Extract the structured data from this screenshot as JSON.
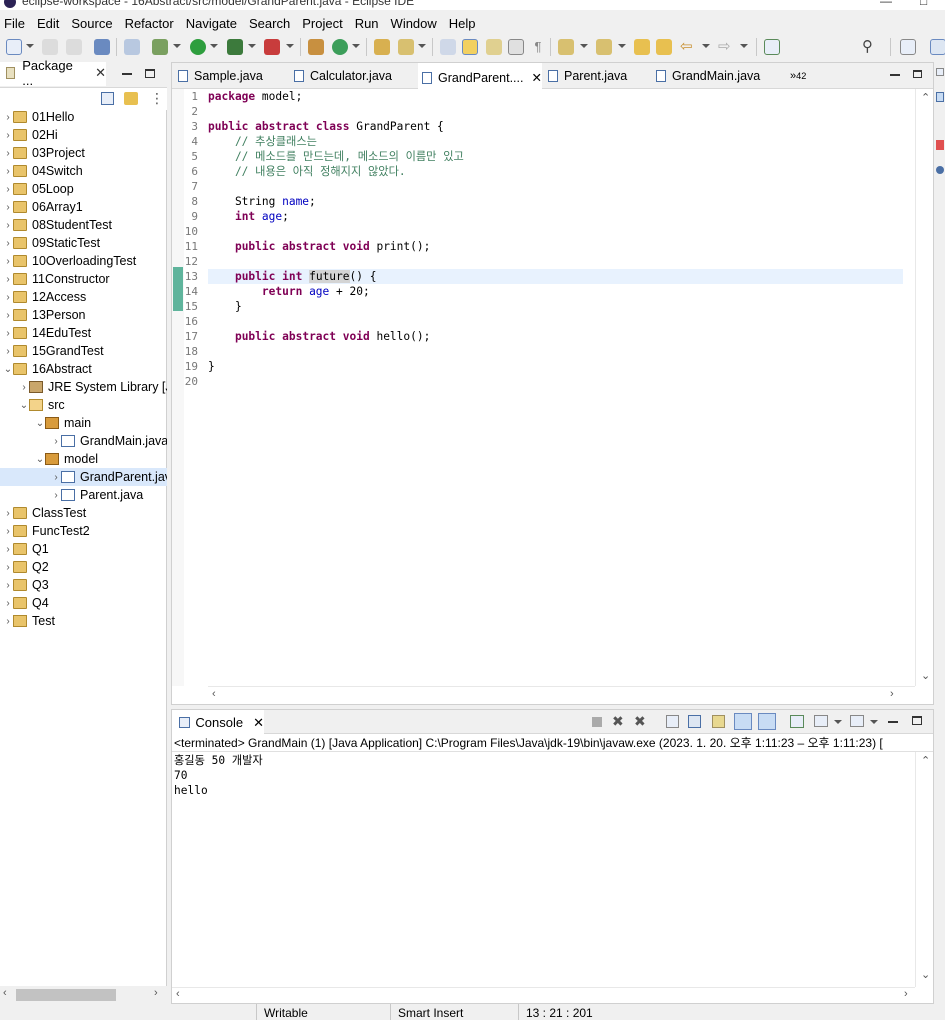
{
  "window": {
    "title": "eclipse-workspace - 16Abstract/src/model/GrandParent.java - Eclipse IDE",
    "min_glyph": "—",
    "max_glyph": "□"
  },
  "menu": [
    "File",
    "Edit",
    "Source",
    "Refactor",
    "Navigate",
    "Search",
    "Project",
    "Run",
    "Window",
    "Help"
  ],
  "package_explorer": {
    "tab_label": "Package ...",
    "close_glyph": "✕",
    "items": [
      {
        "label": "01Hello",
        "level": 0,
        "arrow": "›",
        "icon": "project-icon"
      },
      {
        "label": "02Hi",
        "level": 0,
        "arrow": "›",
        "icon": "project-icon"
      },
      {
        "label": "03Project",
        "level": 0,
        "arrow": "›",
        "icon": "project-icon"
      },
      {
        "label": "04Switch",
        "level": 0,
        "arrow": "›",
        "icon": "project-icon"
      },
      {
        "label": "05Loop",
        "level": 0,
        "arrow": "›",
        "icon": "project-icon"
      },
      {
        "label": "06Array1",
        "level": 0,
        "arrow": "›",
        "icon": "project-icon"
      },
      {
        "label": "08StudentTest",
        "level": 0,
        "arrow": "›",
        "icon": "project-icon"
      },
      {
        "label": "09StaticTest",
        "level": 0,
        "arrow": "›",
        "icon": "project-icon"
      },
      {
        "label": "10OverloadingTest",
        "level": 0,
        "arrow": "›",
        "icon": "project-icon"
      },
      {
        "label": "11Constructor",
        "level": 0,
        "arrow": "›",
        "icon": "project-icon"
      },
      {
        "label": "12Access",
        "level": 0,
        "arrow": "›",
        "icon": "project-icon"
      },
      {
        "label": "13Person",
        "level": 0,
        "arrow": "›",
        "icon": "project-icon"
      },
      {
        "label": "14EduTest",
        "level": 0,
        "arrow": "›",
        "icon": "project-icon"
      },
      {
        "label": "15GrandTest",
        "level": 0,
        "arrow": "›",
        "icon": "project-icon"
      },
      {
        "label": "16Abstract",
        "level": 0,
        "arrow": "⌄",
        "icon": "project-icon"
      },
      {
        "label": "JRE System Library [J",
        "level": 1,
        "arrow": "›",
        "icon": "library-icon"
      },
      {
        "label": "src",
        "level": 1,
        "arrow": "⌄",
        "icon": "source-folder-icon"
      },
      {
        "label": "main",
        "level": 2,
        "arrow": "⌄",
        "icon": "package-icon"
      },
      {
        "label": "GrandMain.java",
        "level": 3,
        "arrow": "›",
        "icon": "java-file-icon"
      },
      {
        "label": "model",
        "level": 2,
        "arrow": "⌄",
        "icon": "package-icon"
      },
      {
        "label": "GrandParent.java",
        "level": 3,
        "arrow": "›",
        "icon": "java-file-icon",
        "selected": true
      },
      {
        "label": "Parent.java",
        "level": 3,
        "arrow": "›",
        "icon": "java-file-icon"
      },
      {
        "label": "ClassTest",
        "level": 0,
        "arrow": "›",
        "icon": "project-icon"
      },
      {
        "label": "FuncTest2",
        "level": 0,
        "arrow": "›",
        "icon": "project-icon"
      },
      {
        "label": "Q1",
        "level": 0,
        "arrow": "›",
        "icon": "project-icon"
      },
      {
        "label": "Q2",
        "level": 0,
        "arrow": "›",
        "icon": "project-icon"
      },
      {
        "label": "Q3",
        "level": 0,
        "arrow": "›",
        "icon": "project-icon"
      },
      {
        "label": "Q4",
        "level": 0,
        "arrow": "›",
        "icon": "project-icon"
      },
      {
        "label": "Test",
        "level": 0,
        "arrow": "›",
        "icon": "error-project-icon"
      }
    ]
  },
  "editor": {
    "tabs": [
      {
        "label": "Sample.java"
      },
      {
        "label": "Calculator.java"
      },
      {
        "label": "GrandParent....",
        "active": true
      },
      {
        "label": "Parent.java"
      },
      {
        "label": "GrandMain.java"
      }
    ],
    "tab_close_glyph": "✕",
    "overflow_label": "»",
    "overflow_count": "42",
    "line_numbers": [
      "1",
      "2",
      "3",
      "4",
      "5",
      "6",
      "7",
      "8",
      "9",
      "10",
      "11",
      "12",
      "13",
      "14",
      "15",
      "16",
      "17",
      "18",
      "19",
      "20"
    ],
    "lines": {
      "l1_kw": "package",
      "l1_rest": " model;",
      "l3_kw1": "public",
      "l3_kw2": "abstract",
      "l3_kw3": "class",
      "l3_rest": " GrandParent {",
      "l4": "    // 추상클래스는",
      "l5": "    // 메소드를 만드는데, 메소드의 이름만 있고",
      "l6": "    // 내용은 아직 정해지지 않았다.",
      "l8_type": "    String ",
      "l8_field": "name",
      "l8_end": ";",
      "l9_kw": "int",
      "l9_field": "age",
      "l9_end": ";",
      "l11_kw1": "public",
      "l11_kw2": "abstract",
      "l11_kw3": "void",
      "l11_rest": " print();",
      "l13_kw1": "public",
      "l13_kw2": "int",
      "l13_name": "future",
      "l13_rest": "() {",
      "l14_kw": "return",
      "l14_field": "age",
      "l14_rest": " + 20;",
      "l15": "    }",
      "l17_kw1": "public",
      "l17_kw2": "abstract",
      "l17_kw3": "void",
      "l17_rest": " hello();",
      "l19": "}"
    }
  },
  "console": {
    "tab_label": "Console",
    "close_glyph": "✕",
    "status": "<terminated> GrandMain (1) [Java Application] C:\\Program Files\\Java\\jdk-19\\bin\\javaw.exe  (2023. 1. 20. 오후 1:11:23 – 오후 1:11:23) [",
    "output": [
      "홍길동 50 개발자",
      "70",
      "hello"
    ]
  },
  "statusbar": {
    "writable": "Writable",
    "insert_mode": "Smart Insert",
    "position": "13 : 21 : 201"
  },
  "colors": {
    "keyword": "#7f0055",
    "comment": "#3f7f5f",
    "field": "#0000c0",
    "selection": "#d9e8fb"
  }
}
